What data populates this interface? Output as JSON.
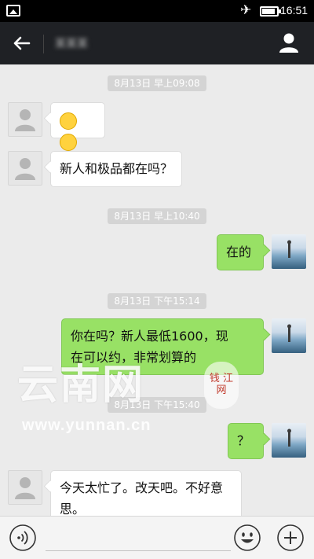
{
  "status_bar": {
    "time": "16:51",
    "airplane_mode": true,
    "battery_level": 0.9,
    "icons": [
      "gallery-icon",
      "airplane-icon",
      "battery-icon"
    ]
  },
  "header": {
    "contact_name": "某某某"
  },
  "messages": [
    {
      "type": "timestamp",
      "text": "8月13日 早上09:08"
    },
    {
      "type": "incoming",
      "emoji_count": 2,
      "text": ""
    },
    {
      "type": "incoming",
      "text": "新人和极品都在吗？"
    },
    {
      "type": "timestamp",
      "text": "8月13日 早上10:40"
    },
    {
      "type": "outgoing",
      "text": "在的"
    },
    {
      "type": "timestamp",
      "text": "8月13日 下午15:14"
    },
    {
      "type": "outgoing",
      "line1": "你在吗？新人最低1600，现",
      "line2": "在可以约，非常划算的"
    },
    {
      "type": "timestamp",
      "text": "8月13日 下午15:40"
    },
    {
      "type": "outgoing",
      "text": "？"
    },
    {
      "type": "incoming",
      "line1": "今天太忙了。改天吧。不好意",
      "line2": "思。"
    }
  ],
  "watermark": {
    "logo": "云南网",
    "url": "www.yunnan.cn",
    "seal": "钱 江 网"
  },
  "input_bar": {
    "placeholder": ""
  },
  "colors": {
    "outgoing_bubble": "#98e165",
    "incoming_bubble": "#ffffff",
    "top_bar": "#1f2125",
    "chat_background": "#ebebeb"
  }
}
